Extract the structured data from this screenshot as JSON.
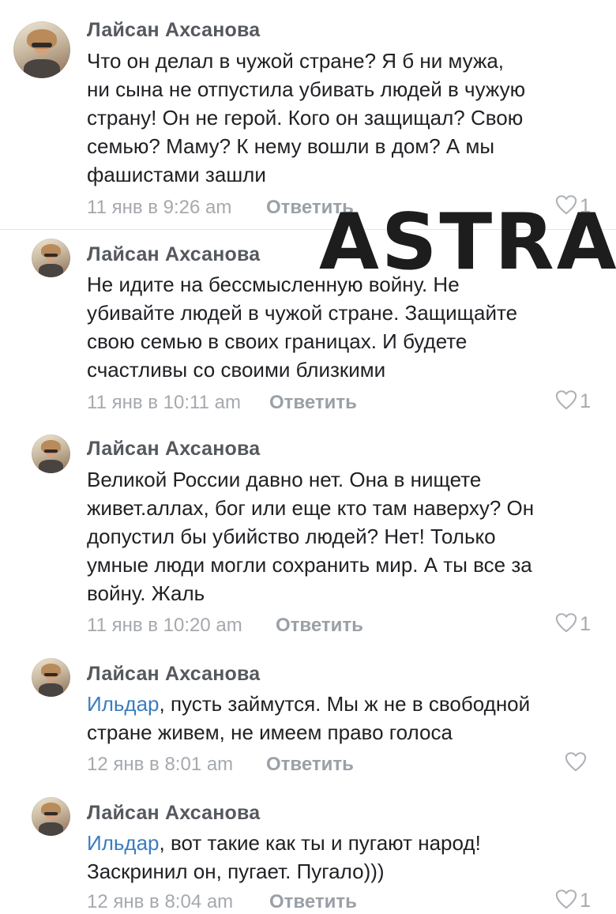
{
  "comments": [
    {
      "author": "Лайсан Ахсанова",
      "lines": [
        "Что он делал в чужой стране?   Я б ни мужа,",
        "ни сына не отпустила убивать людей в чужую",
        "страну! Он не герой. Кого он защищал? Свою",
        "семью? Маму? К нему вошли в дом? А мы",
        "фашистами зашли"
      ],
      "time": "11 янв в 9:26 am",
      "reply_label": "Ответить",
      "likes": "1"
    },
    {
      "author": "Лайсан Ахсанова",
      "lines": [
        "Не идите на бессмысленную войну. Не",
        "убивайте людей в чужой стране. Защищайте",
        "свою семью в своих границах. И будете",
        "счастливы со своими близкими"
      ],
      "time": "11 янв в 10:11 am",
      "reply_label": "Ответить",
      "likes": "1"
    },
    {
      "author": "Лайсан Ахсанова",
      "lines": [
        "Великой России давно нет. Она в нищете",
        "живет.аллах, бог или еще кто там наверху? Он",
        "допустил бы убийство людей? Нет! Только",
        "умные люди могли сохранить мир. А ты все за",
        "войну. Жаль"
      ],
      "time": "11 янв в 10:20 am",
      "reply_label": "Ответить",
      "likes": "1"
    },
    {
      "author": "Лайсан Ахсанова",
      "mention": "Ильдар",
      "lines": [
        ", пусть займутся. Мы ж не в свободной",
        "стране живем, не имеем право голоса"
      ],
      "time": "12 янв в 8:01 am",
      "reply_label": "Ответить",
      "likes": ""
    },
    {
      "author": "Лайсан Ахсанова",
      "mention": "Ильдар",
      "lines": [
        ", вот такие как ты и пугают народ!",
        "Заскринил он, пугает. Пугало)))"
      ],
      "time": "12 янв в 8:04 am",
      "reply_label": "Ответить",
      "likes": "1"
    }
  ],
  "watermark": "ASTRA",
  "colors": {
    "author": "#55595e",
    "text": "#202124",
    "meta": "#a5a9ae",
    "mention": "#3a7cc0",
    "divider": "#e3e4e8"
  },
  "icons": {
    "like": "heart-outline-icon"
  }
}
